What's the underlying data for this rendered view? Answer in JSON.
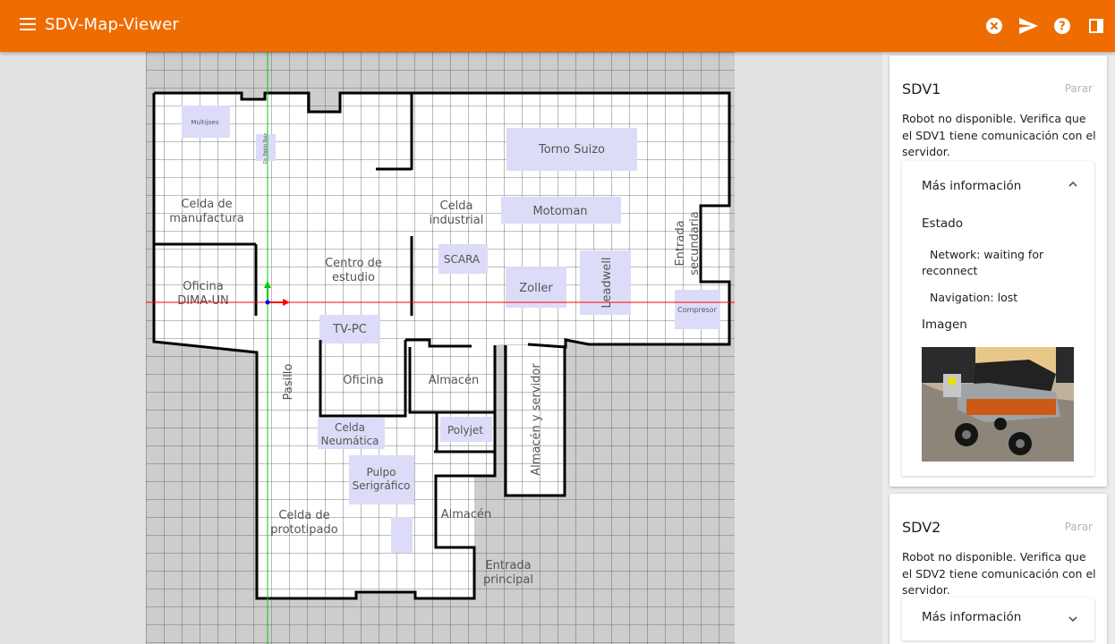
{
  "app": {
    "title": "SDV-Map-Viewer"
  },
  "toolbar": {
    "icons": [
      "close-circle-icon",
      "send-icon",
      "help-icon",
      "panel-toggle-icon"
    ]
  },
  "map": {
    "labels": {
      "multijoes": "Multijoes",
      "small_label": "Dr. Pablo Ruiz",
      "celda_manufactura_1": "Celda de",
      "celda_manufactura_2": "manufactura",
      "celda_industrial_1": "Celda",
      "celda_industrial_2": "industrial",
      "torno_suizo": "Torno Suizo",
      "motoman": "Motoman",
      "entrada_secundaria_1": "Entrada",
      "entrada_secundaria_2": "secundaria",
      "oficina_dima_1": "Oficina",
      "oficina_dima_2": "DIMA-UN",
      "centro_estudio_1": "Centro de",
      "centro_estudio_2": "estudio",
      "scara": "SCARA",
      "zoller": "Zoller",
      "leadwell": "Leadwell",
      "compresor": "Compresor",
      "tv_pc": "TV-PC",
      "pasillo": "Pasillo",
      "oficina": "Oficina",
      "almacen_1": "Almacén",
      "almacen_servidor": "Almacén y servidor",
      "celda_neumatica_1": "Celda",
      "celda_neumatica_2": "Neumática",
      "polyjet": "Polyjet",
      "pulpo_1": "Pulpo",
      "pulpo_2": "Serigráfico",
      "almacen_2": "Almacén",
      "celda_prototipado_1": "Celda de",
      "celda_prototipado_2": "prototipado",
      "entrada_principal_1": "Entrada",
      "entrada_principal_2": "principal"
    }
  },
  "robots": [
    {
      "name": "SDV1",
      "stop_label": "Parar",
      "message": "Robot no disponible. Verifica que el SDV1 tiene comunicación con el servidor.",
      "more_info_label": "Más información",
      "expanded": true,
      "status_heading": "Estado",
      "network_status": "Network: waiting for reconnect",
      "navigation_status": "Navigation: lost",
      "image_heading": "Imagen"
    },
    {
      "name": "SDV2",
      "stop_label": "Parar",
      "message": "Robot no disponible. Verifica que el SDV2 tiene comunicación con el servidor.",
      "more_info_label": "Más información",
      "expanded": false
    }
  ],
  "colors": {
    "appbar": "#ef6c00",
    "grid_bg": "#cdcdcd",
    "room_highlight": "#dcdcf8",
    "axis_x": "#ff0000",
    "axis_y": "#00cc00",
    "axis_z": "#0000ff"
  }
}
